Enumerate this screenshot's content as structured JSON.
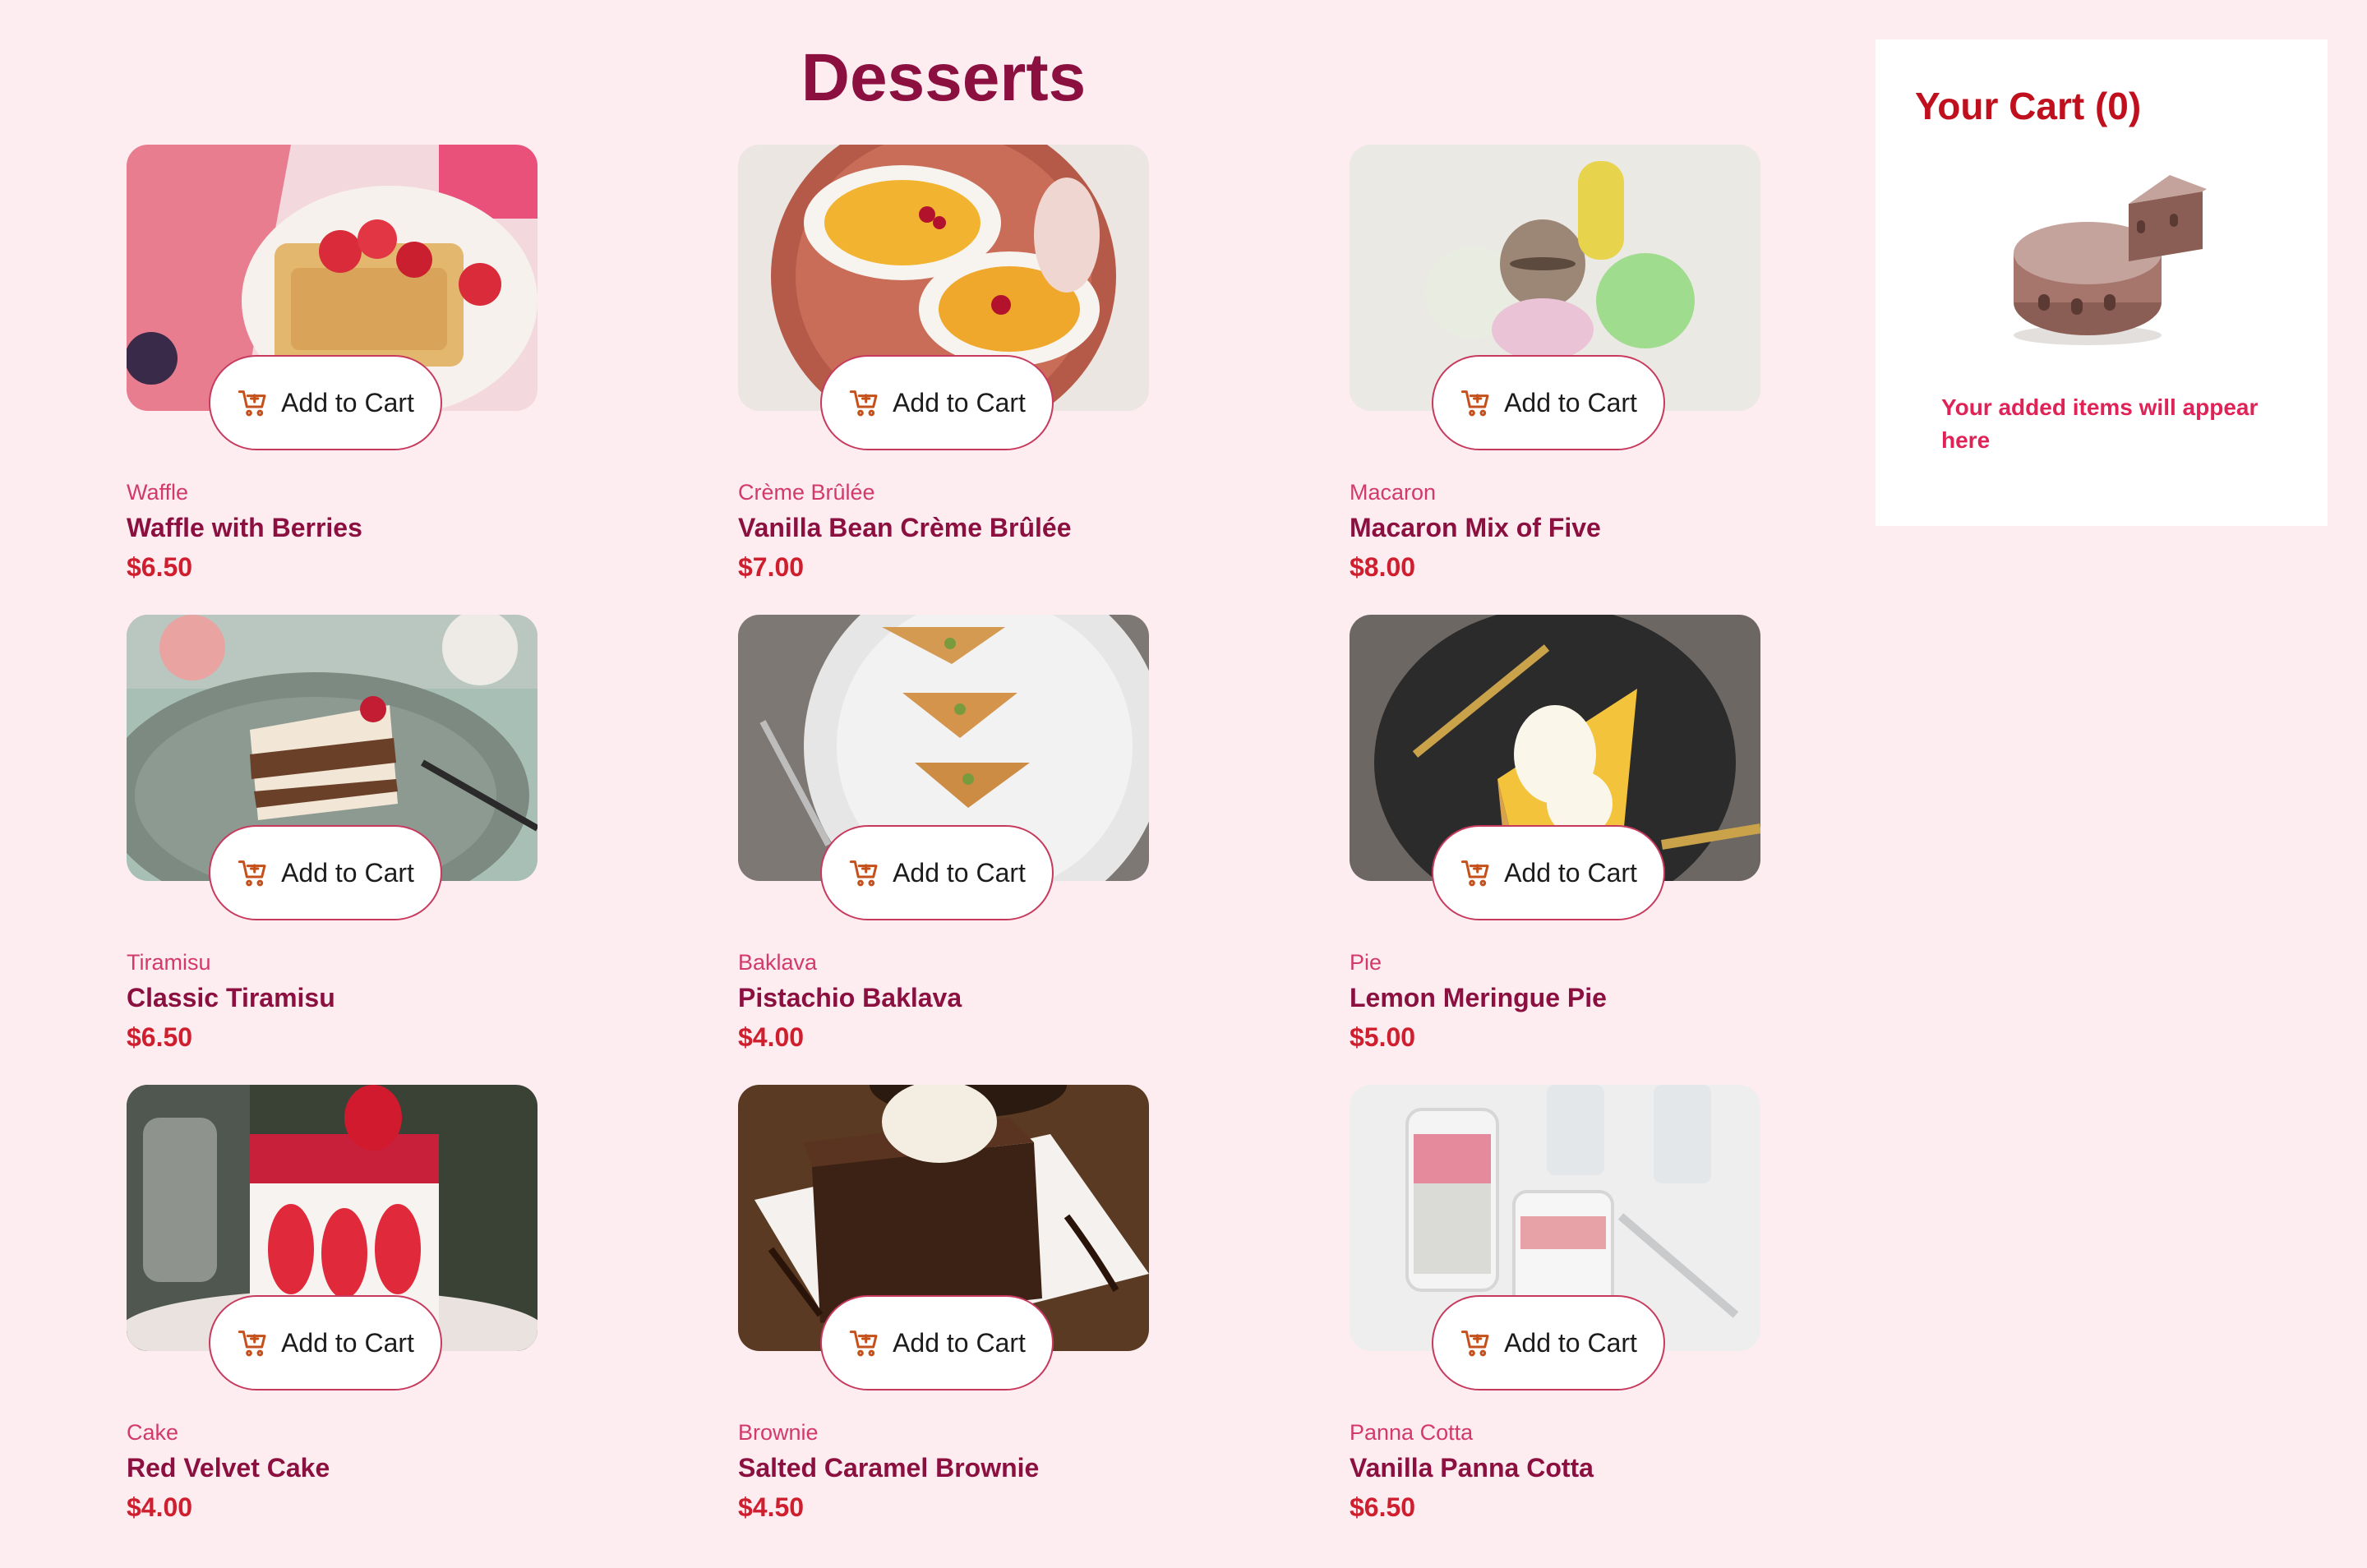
{
  "page": {
    "title": "Desserts"
  },
  "products": [
    {
      "category": "Waffle",
      "name": "Waffle with Berries",
      "price": "$6.50",
      "button": "Add to Cart"
    },
    {
      "category": "Crème Brûlée",
      "name": "Vanilla Bean Crème Brûlée",
      "price": "$7.00",
      "button": "Add to Cart"
    },
    {
      "category": "Macaron",
      "name": "Macaron Mix of Five",
      "price": "$8.00",
      "button": "Add to Cart"
    },
    {
      "category": "Tiramisu",
      "name": "Classic Tiramisu",
      "price": "$6.50",
      "button": "Add to Cart"
    },
    {
      "category": "Baklava",
      "name": "Pistachio Baklava",
      "price": "$4.00",
      "button": "Add to Cart"
    },
    {
      "category": "Pie",
      "name": "Lemon Meringue Pie",
      "price": "$5.00",
      "button": "Add to Cart"
    },
    {
      "category": "Cake",
      "name": "Red Velvet Cake",
      "price": "$4.00",
      "button": "Add to Cart"
    },
    {
      "category": "Brownie",
      "name": "Salted Caramel Brownie",
      "price": "$4.50",
      "button": "Add to Cart"
    },
    {
      "category": "Panna Cotta",
      "name": "Vanilla Panna Cotta",
      "price": "$6.50",
      "button": "Add to Cart"
    }
  ],
  "cart": {
    "title": "Your Cart (0)",
    "empty_message": "Your added items will appear here",
    "illustration": "cake-icon"
  },
  "icons": {
    "button": "add-to-cart-icon"
  },
  "colors": {
    "background": "#fdedf1",
    "heading": "#8b1040",
    "category": "#d23a6b",
    "price": "#cf1f2e",
    "cart_title": "#c0101d",
    "button_border": "#c73a5e"
  }
}
